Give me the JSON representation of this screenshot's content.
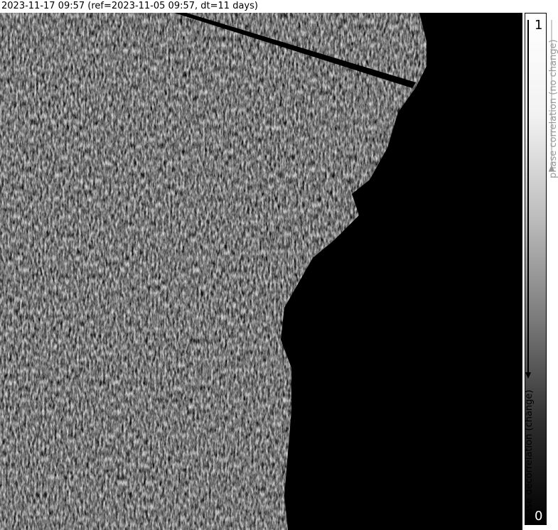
{
  "title": "2023-11-17 09:57 (ref=2023-11-05 09:57, dt=11 days)",
  "colorbar": {
    "top_tick": "1",
    "bottom_tick": "0",
    "top_label": "phase correlation (no change)",
    "bottom_label": "phase decorrelation (change)"
  },
  "colors": {
    "background": "#000000",
    "texture_light": "#d9d9d9",
    "texture_dark": "#1a1a1a"
  }
}
